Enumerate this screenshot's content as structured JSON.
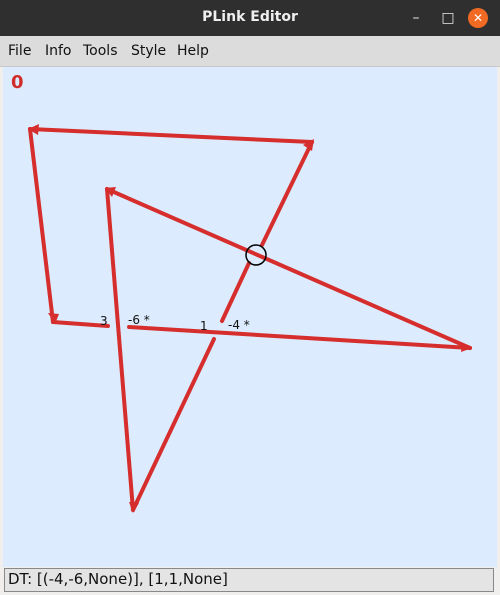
{
  "window": {
    "title": "PLink Editor",
    "minimize": "–",
    "maximize": "□",
    "close": "✕"
  },
  "menu": [
    "File",
    "Info",
    "Tools",
    "Style",
    "Help"
  ],
  "canvas": {
    "counter": "0",
    "labels": [
      {
        "text": "3"
      },
      {
        "text": "-6 *"
      },
      {
        "text": "1"
      },
      {
        "text": "-4 *"
      }
    ],
    "colors": {
      "background": "#dcebfd",
      "strand": "#d62d2d",
      "crossing_marker": "#000000"
    }
  },
  "status": {
    "text": "DT: [(-4,-6,None)], [1,1,None]"
  }
}
